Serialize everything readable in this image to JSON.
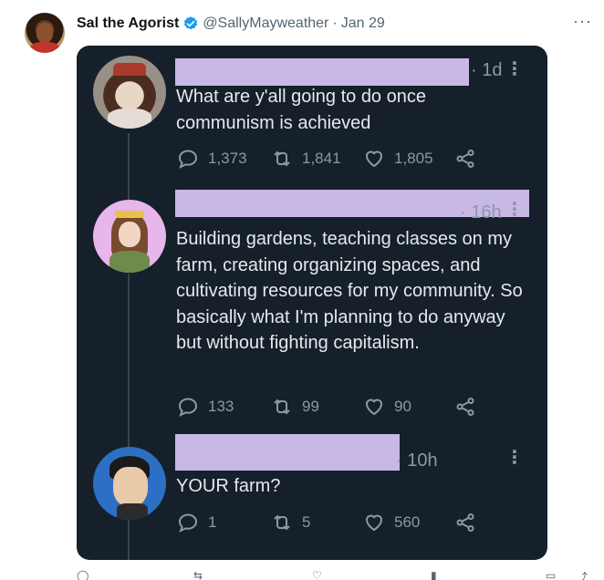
{
  "outer_tweet": {
    "display_name": "Sal the Agorist",
    "handle": "@SallyMayweather",
    "separator": "·",
    "date": "Jan 29",
    "more_glyph": "···"
  },
  "replies": [
    {
      "time": "· 1d",
      "text": "What are y'all going to do once communism is achieved",
      "replies_count": "1,373",
      "retweets_count": "1,841",
      "likes_count": "1,805"
    },
    {
      "time": "· 16h",
      "text": "Building gardens, teaching classes on my farm,  creating organizing spaces, and cultivating resources for my community. So basically what I'm planning to do anyway but without fighting capitalism.",
      "replies_count": "133",
      "retweets_count": "99",
      "likes_count": "90"
    },
    {
      "time": "· 10h",
      "text": "YOUR farm?",
      "replies_count": "1",
      "retweets_count": "5",
      "likes_count": "560"
    }
  ],
  "colors": {
    "card_background": "#15202b",
    "redaction": "#c7b8e6",
    "verified_badge": "#1d9bf0",
    "muted_text": "#8b98a5"
  }
}
